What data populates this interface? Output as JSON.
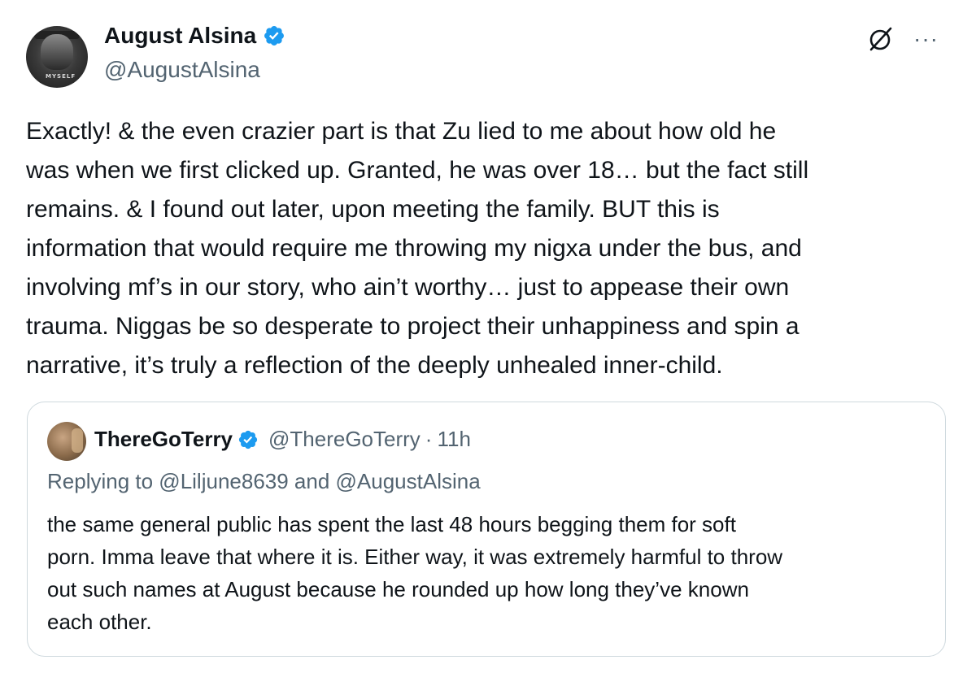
{
  "tweet": {
    "author": {
      "display_name": "August Alsina",
      "handle": "@AugustAlsina",
      "verified": true,
      "avatar_icon": "profile-photo",
      "avatar_text": "MYSELF"
    },
    "body": "Exactly! & the even crazier part is that Zu lied to me about how old he\nwas when we first clicked up. Granted, he was over 18… but the fact still\nremains. & I found out later, upon meeting the family. BUT this is\ninformation that would require me throwing my nigxa under the bus, and\ninvolving mf’s in our story, who ain’t worthy… just to appease their own\ntrauma. Niggas be so desperate to project their unhappiness and spin a\nnarrative, it’s truly a reflection of the deeply unhealed inner-child.",
    "icons": {
      "grok": "grok-icon",
      "more": "···"
    }
  },
  "quote": {
    "author": {
      "display_name": "ThereGoTerry",
      "handle": "@ThereGoTerry",
      "verified": true,
      "separator": "·",
      "time": "11h"
    },
    "replying_to": "Replying to @Liljune8639 and @AugustAlsina",
    "body": "the same general public has spent the last 48 hours begging them for soft\nporn. Imma leave that where it is. Either way, it was extremely harmful to throw\nout such names at August because he rounded up how long they’ve known\neach other."
  },
  "colors": {
    "verified_blue": "#1d9bf0",
    "text_primary": "#0f1419",
    "text_secondary": "#536471",
    "border": "#cfd9de"
  }
}
